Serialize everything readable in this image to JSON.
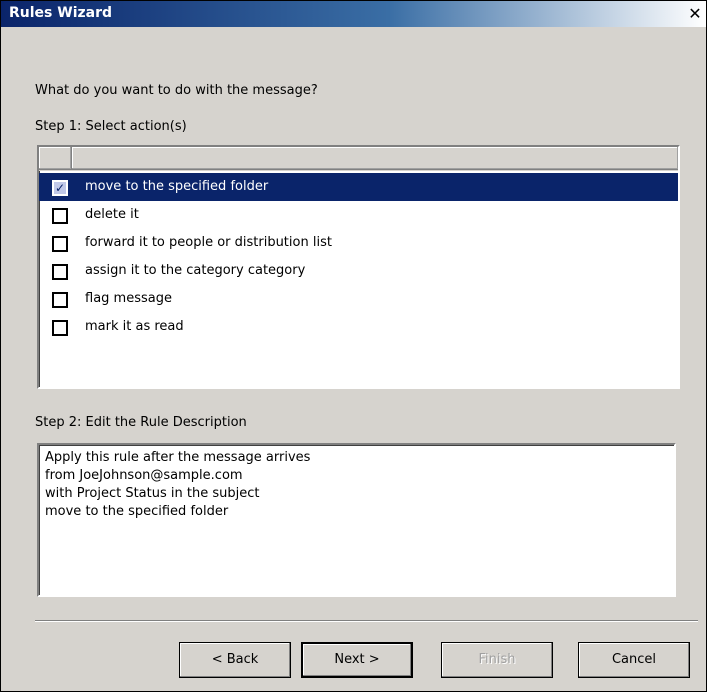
{
  "window": {
    "title": "Rules Wizard",
    "close_glyph": "✕",
    "icons": [
      "close-icon"
    ]
  },
  "prompt": "What do you want to do with the message?",
  "step1": {
    "label": "Step 1: Select action(s)",
    "actions": [
      {
        "label": "move to the specified folder",
        "checked": true,
        "selected": true
      },
      {
        "label": "delete it",
        "checked": false,
        "selected": false
      },
      {
        "label": "forward it to people or distribution list",
        "checked": false,
        "selected": false
      },
      {
        "label": "assign it to the category category",
        "checked": false,
        "selected": false
      },
      {
        "label": "flag message",
        "checked": false,
        "selected": false
      },
      {
        "label": "mark it as read",
        "checked": false,
        "selected": false
      }
    ]
  },
  "step2": {
    "label": "Step 2: Edit the Rule Description",
    "lines": [
      "Apply this rule after the message arrives",
      "from JoeJohnson@sample.com",
      "with Project Status in the subject",
      "move to the specified folder"
    ]
  },
  "buttons": {
    "back": "< Back",
    "next": "Next >",
    "finish": "Finish",
    "cancel": "Cancel"
  },
  "colors": {
    "selection": "#0a246a",
    "dialog_face": "#d6d3ce"
  }
}
